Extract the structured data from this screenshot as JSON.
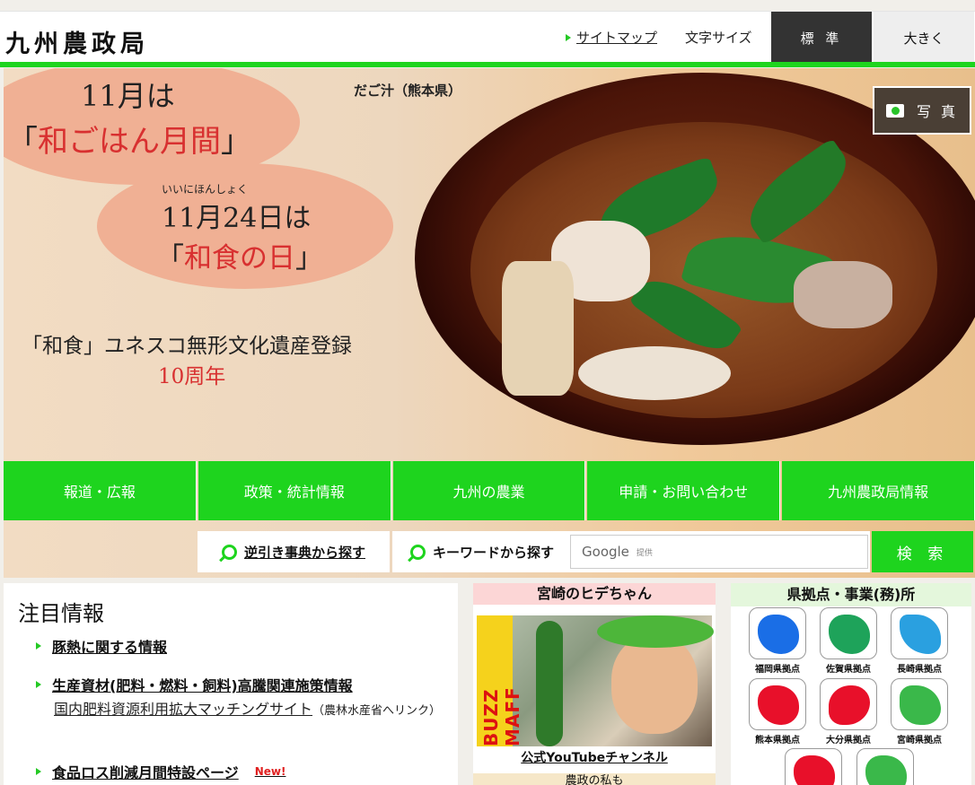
{
  "header": {
    "logo": "九州農政局",
    "sitemap": "サイトマップ",
    "font_size_label": "文字サイズ",
    "font_std": "標 準",
    "font_large": "大きく"
  },
  "hero": {
    "line1": "11月は",
    "line2_pre": "「",
    "line2_red": "和ごはん月間",
    "line2_post": "」",
    "ruby": "いいにほんしょく",
    "line3": "11月24日は",
    "line4_pre": "「",
    "line4_red": "和食の日",
    "line4_post": "」",
    "unesco": "「和食」ユネスコ無形文化遺産登録",
    "anniv": "10周年",
    "caption": "だご汁（熊本県）",
    "photo_btn": "写 真"
  },
  "nav": [
    "報道・広報",
    "政策・統計情報",
    "九州の農業",
    "申請・お問い合わせ",
    "九州農政局情報"
  ],
  "search": {
    "reverse": "逆引き事典から探す",
    "keyword": "キーワードから探す",
    "google": "Google",
    "google_sub": "提供",
    "button": "検 索"
  },
  "notice": {
    "title": "注目情報",
    "items": [
      {
        "label": "豚熱に関する情報"
      },
      {
        "label": "生産資材(肥料・燃料・飼料)高騰関連施策情報",
        "sub": "国内肥料資源利用拡大マッチングサイト",
        "sub_note": "（農林水産省へリンク）"
      },
      {
        "label": "食品ロス削減月間特設ページ",
        "badge": "New!"
      }
    ]
  },
  "youtube": {
    "title": "宮崎のヒデちゃん",
    "brand": "BUZZ MAFF",
    "link": "公式YouTubeチャンネル",
    "footer": "農政の私も"
  },
  "prefs": {
    "title": "県拠点・事業(務)所",
    "items": [
      {
        "label": "福岡県拠点",
        "color": "#1a6ee6"
      },
      {
        "label": "佐賀県拠点",
        "color": "#1ea35a"
      },
      {
        "label": "長崎県拠点",
        "color": "#2aa0e0"
      },
      {
        "label": "熊本県拠点",
        "color": "#e8102a"
      },
      {
        "label": "大分県拠点",
        "color": "#e8102a"
      },
      {
        "label": "宮崎県拠点",
        "color": "#3ab84a"
      },
      {
        "label": "",
        "color": "#e8102a"
      },
      {
        "label": "",
        "color": "#3ab84a"
      }
    ]
  }
}
